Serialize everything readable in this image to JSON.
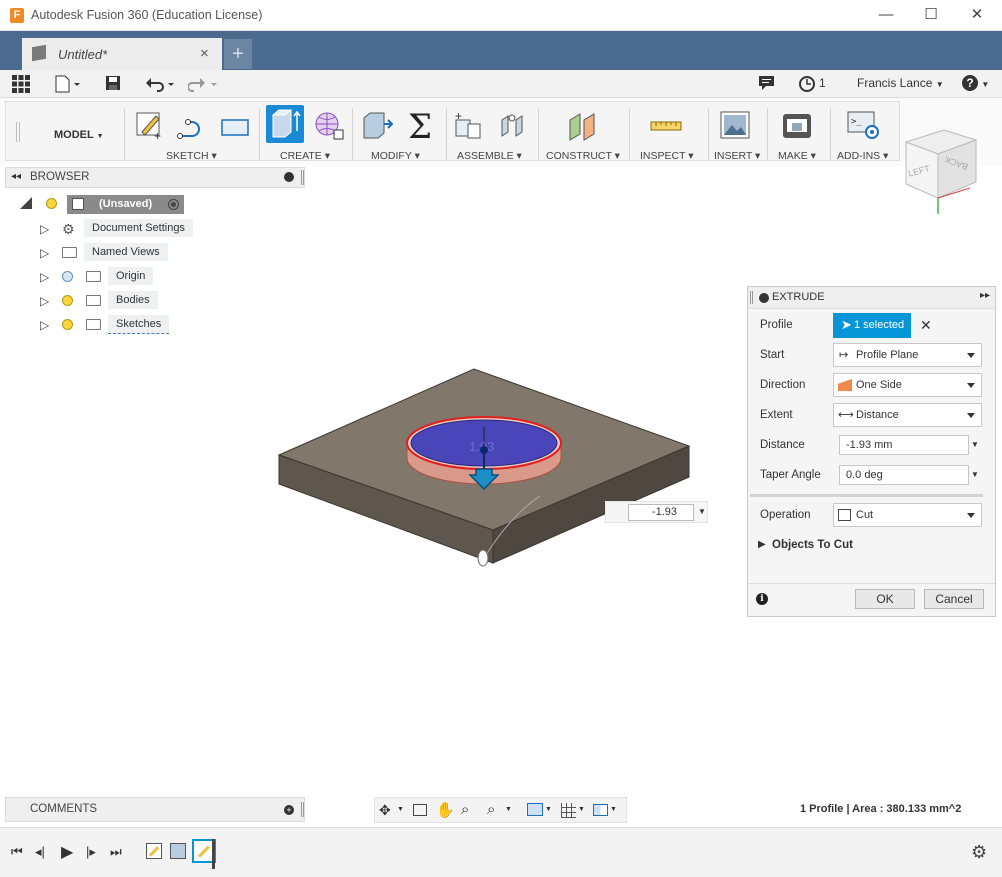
{
  "window": {
    "title": "Autodesk Fusion 360 (Education License)",
    "app_icon": "F"
  },
  "document_tab": {
    "label": "Untitled*",
    "close": "×",
    "new_tab": "+"
  },
  "quickbar": {
    "jobs_count": "1",
    "user": "Francis Lance",
    "help": "?"
  },
  "ribbon": {
    "workspace": "MODEL",
    "groups": [
      "SKETCH",
      "CREATE",
      "MODIFY",
      "ASSEMBLE",
      "CONSTRUCT",
      "INSPECT",
      "INSERT",
      "MAKE",
      "ADD-INS"
    ]
  },
  "viewcube": {
    "left": "LEFT",
    "back": "BACK"
  },
  "browser": {
    "title": "BROWSER",
    "root": "(Unsaved)",
    "items": [
      "Document Settings",
      "Named Views",
      "Origin",
      "Bodies",
      "Sketches"
    ]
  },
  "viewport": {
    "dimension_label": "1.93",
    "input_value": "-1.93"
  },
  "extrude": {
    "title": "EXTRUDE",
    "rows": {
      "profile_label": "Profile",
      "profile_value": "1 selected",
      "start_label": "Start",
      "start_value": "Profile Plane",
      "direction_label": "Direction",
      "direction_value": "One Side",
      "extent_label": "Extent",
      "extent_value": "Distance",
      "distance_label": "Distance",
      "distance_value": "-1.93 mm",
      "taper_label": "Taper Angle",
      "taper_value": "0.0 deg",
      "operation_label": "Operation",
      "operation_value": "Cut",
      "objects_to_cut": "Objects To Cut"
    },
    "ok": "OK",
    "cancel": "Cancel"
  },
  "comments": {
    "title": "COMMENTS"
  },
  "status": {
    "text": "1 Profile | Area : 380.133 mm^2"
  },
  "colors": {
    "tab_strip": "#4a6b8e",
    "accent": "#0696d7",
    "selection": "#4040c0",
    "cut_edge": "#e02020"
  }
}
